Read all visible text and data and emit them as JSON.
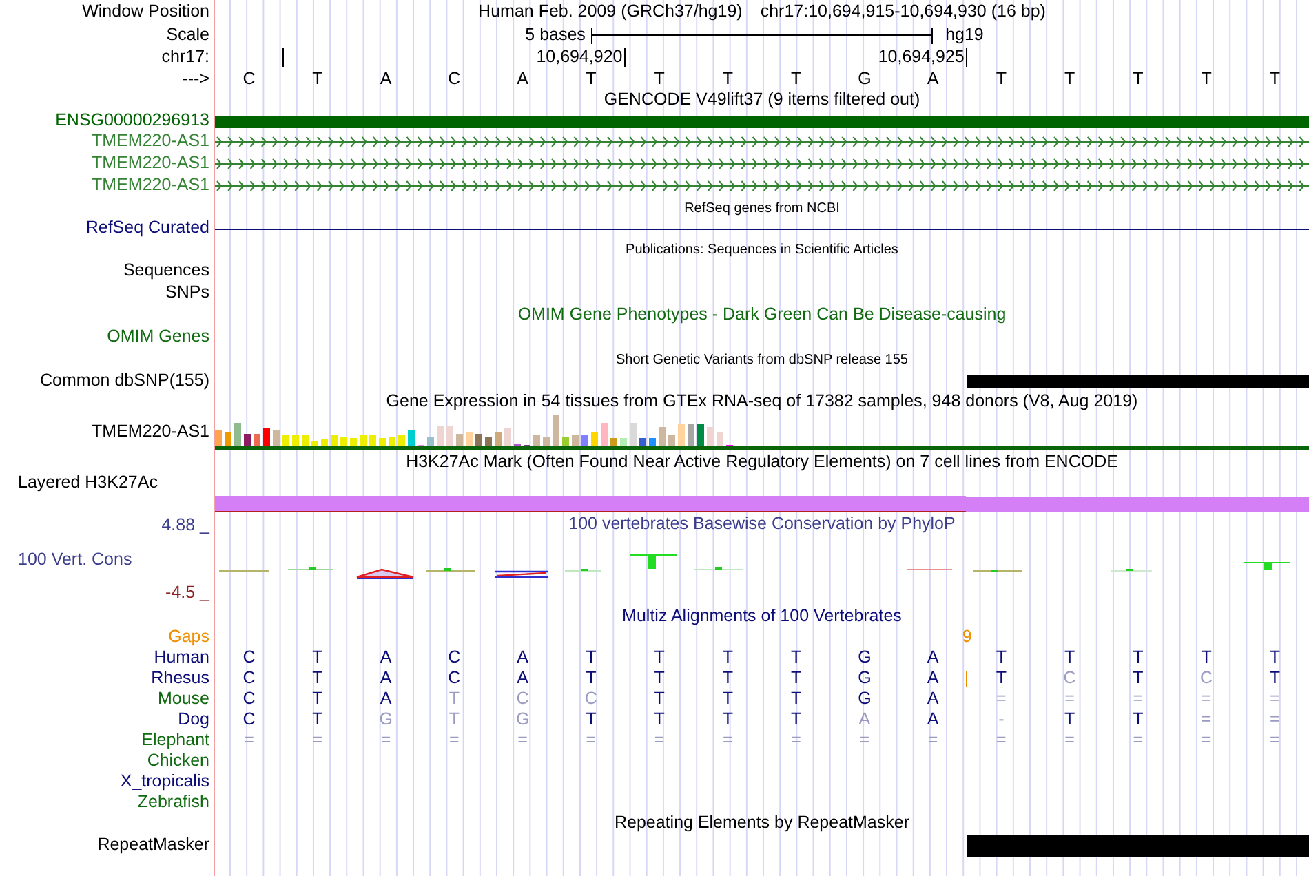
{
  "header": {
    "label": "Window Position",
    "assembly": "Human Feb. 2009 (GRCh37/hg19)",
    "position": "chr17:10,694,915-10,694,930 (16 bp)"
  },
  "scale": {
    "label": "Scale",
    "span": "5 bases",
    "assembly": "hg19"
  },
  "ruler": {
    "label": "chr17:"
  },
  "sequence": {
    "label": "--->",
    "bases": [
      {
        "base": "C",
        "tick": true
      },
      {
        "base": "T",
        "tick": false
      },
      {
        "base": "A",
        "tick": false
      },
      {
        "base": "C",
        "tick": false
      },
      {
        "base": "A",
        "tick": false
      },
      {
        "base": "T",
        "tick": true,
        "tick_label": "10,694,920"
      },
      {
        "base": "T",
        "tick": false
      },
      {
        "base": "T",
        "tick": false
      },
      {
        "base": "T",
        "tick": false
      },
      {
        "base": "G",
        "tick": false
      },
      {
        "base": "A",
        "tick": true,
        "tick_label": "10,694,925"
      },
      {
        "base": "T",
        "tick": false
      },
      {
        "base": "T",
        "tick": false
      },
      {
        "base": "T",
        "tick": false
      },
      {
        "base": "T",
        "tick": false
      },
      {
        "base": "T",
        "tick": false
      }
    ]
  },
  "tracks": [
    {
      "kind": "genes",
      "title": "GENCODE V49lift37 (9 items filtered out)",
      "title_small": false,
      "title_colored": false,
      "color": "#006400",
      "items": [
        {
          "kind": "block",
          "label": "ENSG00000296913"
        },
        {
          "kind": "transcript",
          "label": "TMEM220-AS1"
        },
        {
          "kind": "transcript",
          "label": "TMEM220-AS1"
        },
        {
          "kind": "transcript",
          "label": "TMEM220-AS1"
        }
      ]
    },
    {
      "kind": "line",
      "title": "RefSeq genes from NCBI",
      "title_small": true,
      "title_colored": false,
      "color": "#0c0c78",
      "labels": [
        "RefSeq Curated"
      ]
    },
    {
      "kind": "empty",
      "title": "Publications: Sequences in Scientific Articles",
      "title_small": true,
      "color": "#000000",
      "labels": [
        "Sequences",
        "SNPs"
      ]
    },
    {
      "kind": "empty",
      "title": "OMIM Gene Phenotypes - Dark Green Can Be Disease-causing",
      "title_small": false,
      "title_colored": true,
      "color": "#106b10",
      "labels": [
        "OMIM Genes"
      ]
    },
    {
      "kind": "variants",
      "title": "Short Genetic Variants from dbSNP release 155",
      "title_small": true,
      "color": "#000000",
      "labels": [
        "Common dbSNP(155)"
      ]
    },
    {
      "kind": "expression",
      "title": "Gene Expression in 54 tissues from GTEx RNA-seq of 17382 samples, 948 donors (V8, Aug 2019)",
      "title_small": false,
      "color": "#000000",
      "labels": [
        "TMEM220-AS1"
      ]
    },
    {
      "kind": "layered",
      "title": "H3K27Ac Mark (Often Found Near Active Regulatory Elements) on 7 cell lines from ENCODE",
      "title_small": false,
      "color": "#000000",
      "labels": [
        "Layered H3K27Ac"
      ]
    },
    {
      "kind": "wiggle",
      "title": "100 vertebrates Basewise Conservation by PhyloP",
      "title_small": false,
      "title_colored": true,
      "color": "#3c3c8c",
      "scale_max": "4.88 _",
      "scale_min": "-4.5 _",
      "labels": [
        "100 Vert. Cons"
      ]
    },
    {
      "kind": "alignment",
      "title": "Multiz Alignments of 100 Vertebrates",
      "title_small": false,
      "title_colored": true,
      "color": "#0c0c78",
      "gaps": {
        "label": "Gaps",
        "count": "9"
      },
      "species": [
        {
          "name": "Human",
          "color": "#0c0c78",
          "bases": [
            {
              "base": "C",
              "faded": false,
              "insertion": false
            },
            {
              "base": "T",
              "faded": false,
              "insertion": false
            },
            {
              "base": "A",
              "faded": false,
              "insertion": false
            },
            {
              "base": "C",
              "faded": false,
              "insertion": false
            },
            {
              "base": "A",
              "faded": false,
              "insertion": false
            },
            {
              "base": "T",
              "faded": false,
              "insertion": false
            },
            {
              "base": "T",
              "faded": false,
              "insertion": false
            },
            {
              "base": "T",
              "faded": false,
              "insertion": false
            },
            {
              "base": "T",
              "faded": false,
              "insertion": false
            },
            {
              "base": "G",
              "faded": false,
              "insertion": false
            },
            {
              "base": "A",
              "faded": false,
              "insertion": false
            },
            {
              "base": "T",
              "faded": false,
              "insertion": false
            },
            {
              "base": "T",
              "faded": false,
              "insertion": false
            },
            {
              "base": "T",
              "faded": false,
              "insertion": false
            },
            {
              "base": "T",
              "faded": false,
              "insertion": false
            },
            {
              "base": "T",
              "faded": false,
              "insertion": false
            }
          ]
        },
        {
          "name": "Rhesus",
          "color": "#0c0c78",
          "bases": [
            {
              "base": "C",
              "faded": false,
              "insertion": false
            },
            {
              "base": "T",
              "faded": false,
              "insertion": false
            },
            {
              "base": "A",
              "faded": false,
              "insertion": false
            },
            {
              "base": "C",
              "faded": false,
              "insertion": false
            },
            {
              "base": "A",
              "faded": false,
              "insertion": false
            },
            {
              "base": "T",
              "faded": false,
              "insertion": false
            },
            {
              "base": "T",
              "faded": false,
              "insertion": false
            },
            {
              "base": "T",
              "faded": false,
              "insertion": false
            },
            {
              "base": "T",
              "faded": false,
              "insertion": false
            },
            {
              "base": "G",
              "faded": false,
              "insertion": false
            },
            {
              "base": "A",
              "faded": false,
              "insertion": true
            },
            {
              "base": "T",
              "faded": false,
              "insertion": false
            },
            {
              "base": "C",
              "faded": true,
              "insertion": false
            },
            {
              "base": "T",
              "faded": false,
              "insertion": false
            },
            {
              "base": "C",
              "faded": true,
              "insertion": false
            },
            {
              "base": "T",
              "faded": false,
              "insertion": false
            }
          ]
        },
        {
          "name": "Mouse",
          "color": "#106b10",
          "bases": [
            {
              "base": "C",
              "faded": false,
              "insertion": false
            },
            {
              "base": "T",
              "faded": false,
              "insertion": false
            },
            {
              "base": "A",
              "faded": false,
              "insertion": false
            },
            {
              "base": "T",
              "faded": true,
              "insertion": false
            },
            {
              "base": "C",
              "faded": true,
              "insertion": false
            },
            {
              "base": "C",
              "faded": true,
              "insertion": false
            },
            {
              "base": "T",
              "faded": false,
              "insertion": false
            },
            {
              "base": "T",
              "faded": false,
              "insertion": false
            },
            {
              "base": "T",
              "faded": false,
              "insertion": false
            },
            {
              "base": "G",
              "faded": false,
              "insertion": false
            },
            {
              "base": "A",
              "faded": false,
              "insertion": false
            },
            {
              "base": "=",
              "faded": true,
              "insertion": false
            },
            {
              "base": "=",
              "faded": true,
              "insertion": false
            },
            {
              "base": "=",
              "faded": true,
              "insertion": false
            },
            {
              "base": "=",
              "faded": true,
              "insertion": false
            },
            {
              "base": "=",
              "faded": true,
              "insertion": false
            }
          ]
        },
        {
          "name": "Dog",
          "color": "#0c0c78",
          "bases": [
            {
              "base": "C",
              "faded": false,
              "insertion": false
            },
            {
              "base": "T",
              "faded": false,
              "insertion": false
            },
            {
              "base": "G",
              "faded": true,
              "insertion": false
            },
            {
              "base": "T",
              "faded": true,
              "insertion": false
            },
            {
              "base": "G",
              "faded": true,
              "insertion": false
            },
            {
              "base": "T",
              "faded": false,
              "insertion": false
            },
            {
              "base": "T",
              "faded": false,
              "insertion": false
            },
            {
              "base": "T",
              "faded": false,
              "insertion": false
            },
            {
              "base": "T",
              "faded": false,
              "insertion": false
            },
            {
              "base": "A",
              "faded": true,
              "insertion": false
            },
            {
              "base": "A",
              "faded": false,
              "insertion": false
            },
            {
              "base": "-",
              "faded": true,
              "insertion": false
            },
            {
              "base": "T",
              "faded": false,
              "insertion": false
            },
            {
              "base": "T",
              "faded": false,
              "insertion": false
            },
            {
              "base": "=",
              "faded": true,
              "insertion": false
            },
            {
              "base": "=",
              "faded": true,
              "insertion": false
            }
          ]
        },
        {
          "name": "Elephant",
          "color": "#106b10",
          "bases": [
            {
              "base": "=",
              "faded": true,
              "insertion": false
            },
            {
              "base": "=",
              "faded": true,
              "insertion": false
            },
            {
              "base": "=",
              "faded": true,
              "insertion": false
            },
            {
              "base": "=",
              "faded": true,
              "insertion": false
            },
            {
              "base": "=",
              "faded": true,
              "insertion": false
            },
            {
              "base": "=",
              "faded": true,
              "insertion": false
            },
            {
              "base": "=",
              "faded": true,
              "insertion": false
            },
            {
              "base": "=",
              "faded": true,
              "insertion": false
            },
            {
              "base": "=",
              "faded": true,
              "insertion": false
            },
            {
              "base": "=",
              "faded": true,
              "insertion": false
            },
            {
              "base": "=",
              "faded": true,
              "insertion": false
            },
            {
              "base": "=",
              "faded": true,
              "insertion": false
            },
            {
              "base": "=",
              "faded": true,
              "insertion": false
            },
            {
              "base": "=",
              "faded": true,
              "insertion": false
            },
            {
              "base": "=",
              "faded": true,
              "insertion": false
            },
            {
              "base": "=",
              "faded": true,
              "insertion": false
            }
          ]
        },
        {
          "name": "Chicken",
          "color": "#106b10"
        },
        {
          "name": "X_tropicalis",
          "color": "#0c0c78"
        },
        {
          "name": "Zebrafish",
          "color": "#106b10"
        }
      ]
    },
    {
      "kind": "repeats",
      "title": "Repeating Elements by RepeatMasker",
      "title_small": false,
      "color": "#000000",
      "labels": [
        "RepeatMasker"
      ]
    }
  ]
}
